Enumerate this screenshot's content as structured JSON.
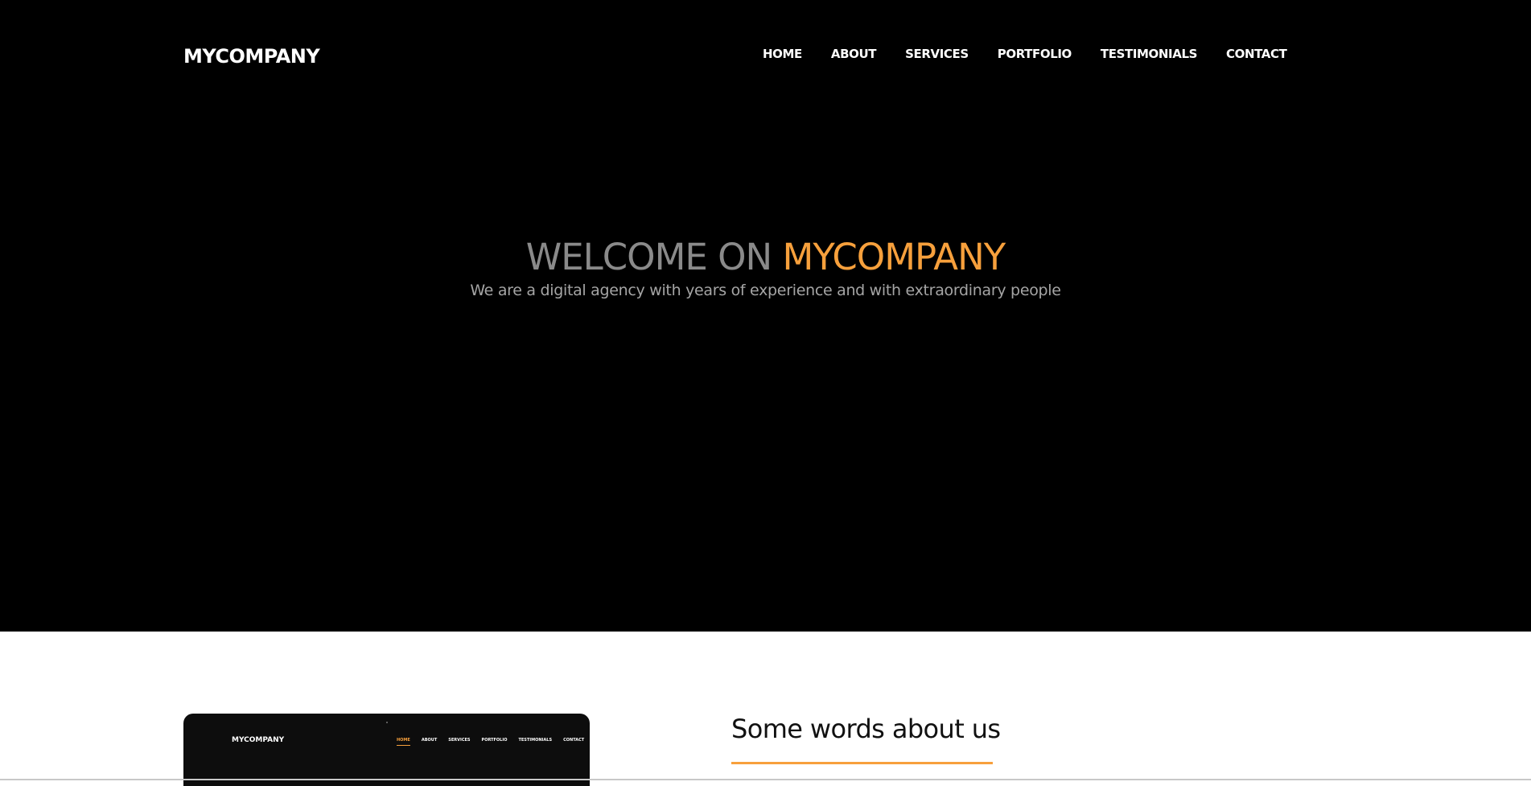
{
  "header": {
    "logo": "MYCOMPANY",
    "nav": [
      {
        "label": "HOME"
      },
      {
        "label": "ABOUT"
      },
      {
        "label": "SERVICES"
      },
      {
        "label": "PORTFOLIO"
      },
      {
        "label": "TESTIMONIALS"
      },
      {
        "label": "CONTACT"
      }
    ]
  },
  "hero": {
    "title_prefix": "WELCOME ON ",
    "title_brand": "MYCOMPANY",
    "subtitle": "We are a digital agency with years of experience and with extraordinary people"
  },
  "about": {
    "heading": "Some words about us",
    "mockup": {
      "logo": "MYCOMPANY",
      "nav": [
        {
          "label": "HOME"
        },
        {
          "label": "ABOUT"
        },
        {
          "label": "SERVICES"
        },
        {
          "label": "PORTFOLIO"
        },
        {
          "label": "TESTIMONIALS"
        },
        {
          "label": "CONTACT"
        }
      ]
    }
  },
  "colors": {
    "accent": "#f7a03c",
    "hero_background": "#000000",
    "title_gray": "#8a8a8a"
  }
}
